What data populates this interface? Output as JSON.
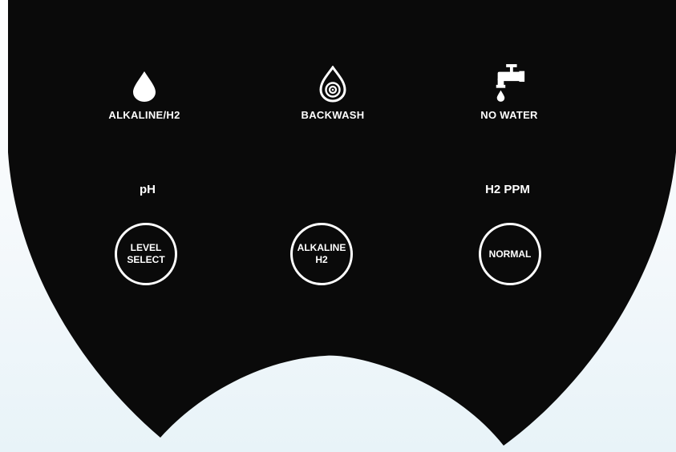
{
  "panel": {
    "background_color": "#0a0a0a",
    "text_color": "#ffffff"
  },
  "indicators": [
    {
      "icon": "water-drop-icon",
      "label": "ALKALINE/H2"
    },
    {
      "icon": "spiral-drop-icon",
      "label": "BACKWASH"
    },
    {
      "icon": "faucet-icon",
      "label": "NO WATER"
    }
  ],
  "readouts": {
    "left_label": "pH",
    "right_label": "H2 PPM"
  },
  "buttons": [
    {
      "label": "LEVEL\nSELECT"
    },
    {
      "label": "ALKALINE\nH2"
    },
    {
      "label": "NORMAL"
    }
  ]
}
